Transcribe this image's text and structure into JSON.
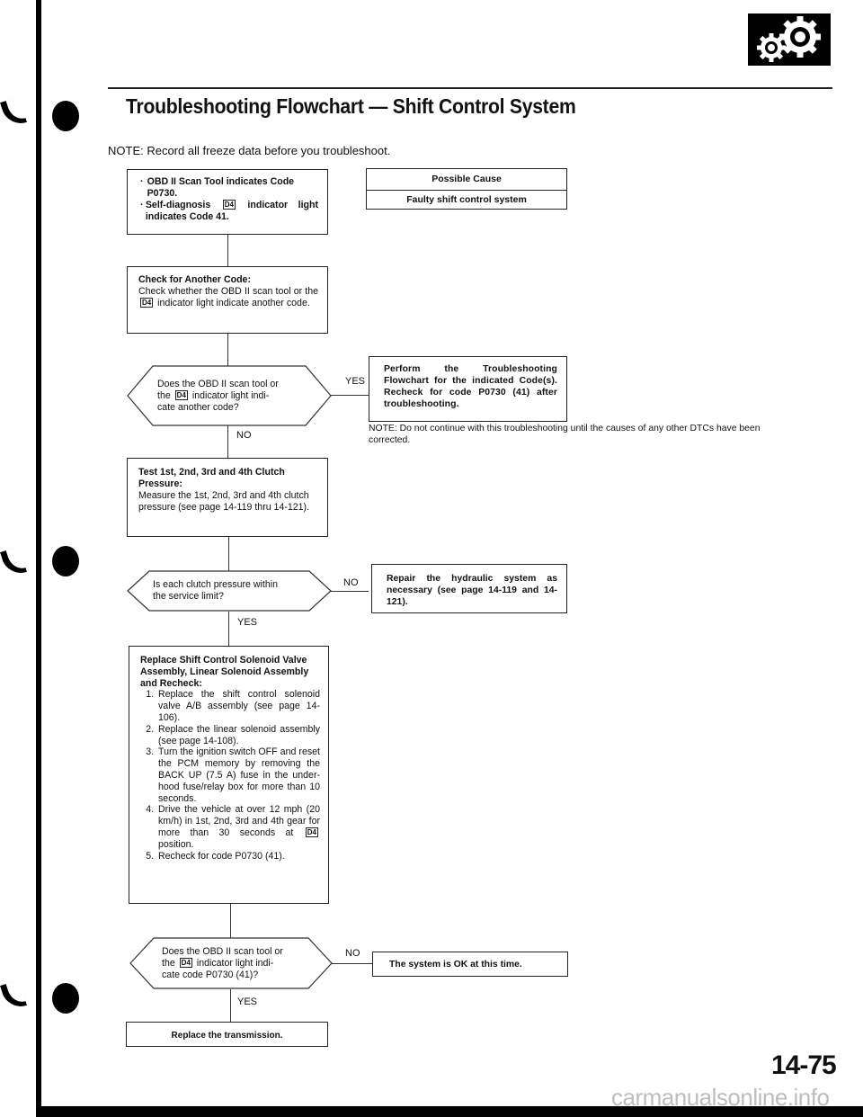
{
  "header": {
    "section_icon": "gears-icon",
    "title": "Troubleshooting Flowchart — Shift Control System",
    "note": "NOTE:  Record all freeze data before you troubleshoot."
  },
  "indicator_symbol": "D4",
  "possible_cause": {
    "heading": "Possible Cause",
    "value": "Faulty shift control system"
  },
  "flow": {
    "start": {
      "bullet1": "OBD II Scan Tool indicates Code P0730.",
      "bullet2_pre": "Self-diagnosis",
      "bullet2_post": "indicator light indicates Code 41."
    },
    "check_code": {
      "heading": "Check for Another Code:",
      "body_pre": "Check whether the OBD II scan tool or the",
      "body_post": "indicator light indicate another code."
    },
    "decision1": {
      "line1": "Does the OBD II scan tool or",
      "line2_pre": "the",
      "line2_post": "indicator light indi-",
      "line3": "cate another code?",
      "yes_label": "YES",
      "no_label": "NO"
    },
    "perform_box": {
      "text": "Perform the Troubleshooting Flowchart for the indicated Code(s). Recheck for code P0730 (41) after troubleshooting.",
      "note": "NOTE:  Do not continue with this troubleshooting until the causes of any other DTCs have been corrected."
    },
    "test_clutch": {
      "heading": "Test 1st, 2nd, 3rd and 4th Clutch Pressure:",
      "body": "Measure the 1st, 2nd, 3rd and 4th clutch pressure (see page 14-119 thru 14-121)."
    },
    "decision2": {
      "line1": "Is each clutch pressure within",
      "line2": "the service limit?",
      "yes_label": "YES",
      "no_label": "NO"
    },
    "repair_box": {
      "text": "Repair the hydraulic system as necessary (see page 14-119 and 14-121)."
    },
    "replace_solenoid": {
      "heading": "Replace Shift Control Solenoid Valve Assembly, Linear Solenoid Assembly and Recheck:",
      "steps": [
        "Replace the shift control solenoid valve A/B assembly (see page 14-106).",
        "Replace the linear solenoid assembly (see page 14-108).",
        "Turn the ignition switch OFF and reset the PCM memory by removing the BACK UP (7.5 A) fuse in the under-hood fuse/relay box for more than 10 seconds.",
        "Drive the vehicle at over 12 mph (20 km/h) in 1st, 2nd, 3rd and 4th gear for more than 30 seconds at",
        "Recheck for code P0730 (41)."
      ],
      "step4_suffix": "position."
    },
    "decision3": {
      "line1": "Does the OBD II scan tool or",
      "line2_pre": "the",
      "line2_post": "indicator light indi-",
      "line3": "cate code P0730 (41)?",
      "yes_label": "YES",
      "no_label": "NO"
    },
    "ok_box": {
      "text": "The system is OK at this time."
    },
    "replace_transmission": {
      "text": "Replace the transmission."
    }
  },
  "footer": {
    "page_number": "14-75",
    "watermark": "carmanualsonline.info"
  }
}
